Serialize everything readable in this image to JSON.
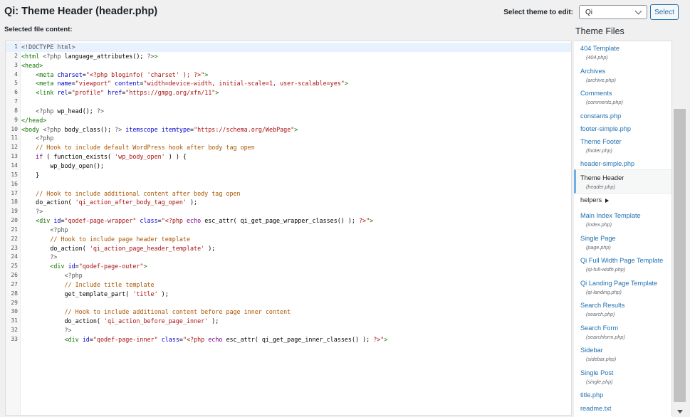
{
  "header": {
    "title": "Qi: Theme Header (header.php)",
    "theme_label": "Select theme to edit:",
    "theme_value": "Qi",
    "select_button": "Select"
  },
  "editor": {
    "label": "Selected file content:",
    "lines": [
      [
        [
          "t-meta",
          "<!DOCTYPE html>"
        ]
      ],
      [
        [
          "t-tag",
          "<html"
        ],
        [
          "t-plain",
          " "
        ],
        [
          "t-meta",
          "<?php"
        ],
        [
          "t-plain",
          " language_attributes(); "
        ],
        [
          "t-meta",
          "?>"
        ],
        [
          "t-tag",
          ">"
        ]
      ],
      [
        [
          "t-tag",
          "<head>"
        ]
      ],
      [
        [
          "t-plain",
          "    "
        ],
        [
          "t-tag",
          "<meta"
        ],
        [
          "t-plain",
          " "
        ],
        [
          "t-attr",
          "charset"
        ],
        [
          "t-plain",
          "="
        ],
        [
          "t-str",
          "\"<?php bloginfo( 'charset' ); ?>\""
        ],
        [
          "t-tag",
          ">"
        ]
      ],
      [
        [
          "t-plain",
          "    "
        ],
        [
          "t-tag",
          "<meta"
        ],
        [
          "t-plain",
          " "
        ],
        [
          "t-attr",
          "name"
        ],
        [
          "t-plain",
          "="
        ],
        [
          "t-str",
          "\"viewport\""
        ],
        [
          "t-plain",
          " "
        ],
        [
          "t-attr",
          "content"
        ],
        [
          "t-plain",
          "="
        ],
        [
          "t-str",
          "\"width=device-width, initial-scale=1, user-scalable=yes\""
        ],
        [
          "t-tag",
          ">"
        ]
      ],
      [
        [
          "t-plain",
          "    "
        ],
        [
          "t-tag",
          "<link"
        ],
        [
          "t-plain",
          " "
        ],
        [
          "t-attr",
          "rel"
        ],
        [
          "t-plain",
          "="
        ],
        [
          "t-str",
          "\"profile\""
        ],
        [
          "t-plain",
          " "
        ],
        [
          "t-attr",
          "href"
        ],
        [
          "t-plain",
          "="
        ],
        [
          "t-str",
          "\"https://gmpg.org/xfn/11\""
        ],
        [
          "t-tag",
          ">"
        ]
      ],
      [],
      [
        [
          "t-plain",
          "    "
        ],
        [
          "t-meta",
          "<?php"
        ],
        [
          "t-plain",
          " wp_head(); "
        ],
        [
          "t-meta",
          "?>"
        ]
      ],
      [
        [
          "t-tag",
          "</head>"
        ]
      ],
      [
        [
          "t-tag",
          "<body"
        ],
        [
          "t-plain",
          " "
        ],
        [
          "t-meta",
          "<?php"
        ],
        [
          "t-plain",
          " body_class(); "
        ],
        [
          "t-meta",
          "?>"
        ],
        [
          "t-plain",
          " "
        ],
        [
          "t-attr",
          "itemscope"
        ],
        [
          "t-plain",
          " "
        ],
        [
          "t-attr",
          "itemtype"
        ],
        [
          "t-plain",
          "="
        ],
        [
          "t-str",
          "\"https://schema.org/WebPage\""
        ],
        [
          "t-tag",
          ">"
        ]
      ],
      [
        [
          "t-plain",
          "    "
        ],
        [
          "t-meta",
          "<?php"
        ]
      ],
      [
        [
          "t-plain",
          "    "
        ],
        [
          "t-com",
          "// Hook to include default WordPress hook after body tag open"
        ]
      ],
      [
        [
          "t-plain",
          "    "
        ],
        [
          "t-kw",
          "if"
        ],
        [
          "t-plain",
          " ( function_exists( "
        ],
        [
          "t-str",
          "'wp_body_open'"
        ],
        [
          "t-plain",
          " ) ) {"
        ]
      ],
      [
        [
          "t-plain",
          "        wp_body_open();"
        ]
      ],
      [
        [
          "t-plain",
          "    }"
        ]
      ],
      [],
      [
        [
          "t-plain",
          "    "
        ],
        [
          "t-com",
          "// Hook to include additional content after body tag open"
        ]
      ],
      [
        [
          "t-plain",
          "    do_action( "
        ],
        [
          "t-str",
          "'qi_action_after_body_tag_open'"
        ],
        [
          "t-plain",
          " );"
        ]
      ],
      [
        [
          "t-plain",
          "    "
        ],
        [
          "t-meta",
          "?>"
        ]
      ],
      [
        [
          "t-plain",
          "    "
        ],
        [
          "t-tag",
          "<div"
        ],
        [
          "t-plain",
          " "
        ],
        [
          "t-attr",
          "id"
        ],
        [
          "t-plain",
          "="
        ],
        [
          "t-str",
          "\"qodef-page-wrapper\""
        ],
        [
          "t-plain",
          " "
        ],
        [
          "t-attr",
          "class"
        ],
        [
          "t-plain",
          "="
        ],
        [
          "t-str",
          "\"<?php "
        ],
        [
          "t-kw",
          "echo"
        ],
        [
          "t-plain",
          " esc_attr( qi_get_page_wrapper_classes() ); "
        ],
        [
          "t-str",
          "?>\""
        ],
        [
          "t-tag",
          ">"
        ]
      ],
      [
        [
          "t-plain",
          "        "
        ],
        [
          "t-meta",
          "<?php"
        ]
      ],
      [
        [
          "t-plain",
          "        "
        ],
        [
          "t-com",
          "// Hook to include page header template"
        ]
      ],
      [
        [
          "t-plain",
          "        do_action( "
        ],
        [
          "t-str",
          "'qi_action_page_header_template'"
        ],
        [
          "t-plain",
          " );"
        ]
      ],
      [
        [
          "t-plain",
          "        "
        ],
        [
          "t-meta",
          "?>"
        ]
      ],
      [
        [
          "t-plain",
          "        "
        ],
        [
          "t-tag",
          "<div"
        ],
        [
          "t-plain",
          " "
        ],
        [
          "t-attr",
          "id"
        ],
        [
          "t-plain",
          "="
        ],
        [
          "t-str",
          "\"qodef-page-outer\""
        ],
        [
          "t-tag",
          ">"
        ]
      ],
      [
        [
          "t-plain",
          "            "
        ],
        [
          "t-meta",
          "<?php"
        ]
      ],
      [
        [
          "t-plain",
          "            "
        ],
        [
          "t-com",
          "// Include title template"
        ]
      ],
      [
        [
          "t-plain",
          "            get_template_part( "
        ],
        [
          "t-str",
          "'title'"
        ],
        [
          "t-plain",
          " );"
        ]
      ],
      [],
      [
        [
          "t-plain",
          "            "
        ],
        [
          "t-com",
          "// Hook to include additional content before page inner content"
        ]
      ],
      [
        [
          "t-plain",
          "            do_action( "
        ],
        [
          "t-str",
          "'qi_action_before_page_inner'"
        ],
        [
          "t-plain",
          " );"
        ]
      ],
      [
        [
          "t-plain",
          "            "
        ],
        [
          "t-meta",
          "?>"
        ]
      ],
      [
        [
          "t-plain",
          "            "
        ],
        [
          "t-tag",
          "<div"
        ],
        [
          "t-plain",
          " "
        ],
        [
          "t-attr",
          "id"
        ],
        [
          "t-plain",
          "="
        ],
        [
          "t-str",
          "\"qodef-page-inner\""
        ],
        [
          "t-plain",
          " "
        ],
        [
          "t-attr",
          "class"
        ],
        [
          "t-plain",
          "="
        ],
        [
          "t-str",
          "\"<?php "
        ],
        [
          "t-kw",
          "echo"
        ],
        [
          "t-plain",
          " esc_attr( qi_get_page_inner_classes() ); "
        ],
        [
          "t-str",
          "?>\""
        ],
        [
          "t-tag",
          ">"
        ]
      ]
    ]
  },
  "sidebar": {
    "title": "Theme Files",
    "files": [
      {
        "name": "404 Template",
        "sub": "(404.php)"
      },
      {
        "name": "Archives",
        "sub": "(archive.php)"
      },
      {
        "name": "Comments",
        "sub": "(comments.php)"
      },
      {
        "name": "constants.php",
        "sub": ""
      },
      {
        "name": "footer-simple.php",
        "sub": ""
      },
      {
        "name": "Theme Footer",
        "sub": "(footer.php)"
      },
      {
        "name": "header-simple.php",
        "sub": ""
      },
      {
        "name": "Theme Header",
        "sub": "(header.php)",
        "active": true
      },
      {
        "name": "helpers",
        "sub": "",
        "folder": true
      },
      {
        "name": "Main Index Template",
        "sub": "(index.php)"
      },
      {
        "name": "Single Page",
        "sub": "(page.php)"
      },
      {
        "name": "Qi Full Width Page Template",
        "sub": "(qi-full-width.php)"
      },
      {
        "name": "Qi Landing Page Template",
        "sub": "(qi-landing.php)"
      },
      {
        "name": "Search Results",
        "sub": "(search.php)"
      },
      {
        "name": "Search Form",
        "sub": "(searchform.php)"
      },
      {
        "name": "Sidebar",
        "sub": "(sidebar.php)"
      },
      {
        "name": "Single Post",
        "sub": "(single.php)"
      },
      {
        "name": "title.php",
        "sub": ""
      },
      {
        "name": "readme.txt",
        "sub": ""
      }
    ]
  }
}
